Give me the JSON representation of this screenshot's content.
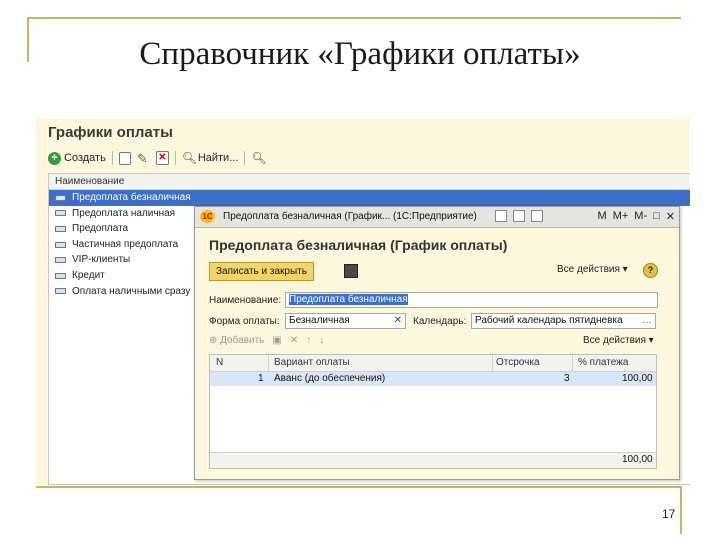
{
  "slide": {
    "title": "Справочник «Графики оплаты»",
    "page_number": "17"
  },
  "list_form": {
    "title": "Графики оплаты",
    "toolbar": {
      "create_label": "Создать",
      "find_label": "Найти..."
    },
    "column_header": "Наименование",
    "items": [
      "Предоплата безналичная",
      "Предоплата наличная",
      "Предоплата",
      "Частичная предоплата",
      "VIP-клиенты",
      "Кредит",
      "Оплата наличными сразу"
    ],
    "selected_index": 0
  },
  "dialog": {
    "window_title": "Предоплата безналичная (График... (1С:Предприятие)",
    "window_controls": [
      "M",
      "M+",
      "M-",
      "□",
      "✕"
    ],
    "heading": "Предоплата безналичная (График оплаты)",
    "save_close_label": "Записать и закрыть",
    "all_actions_label": "Все действия ▾",
    "help_label": "?",
    "name_label": "Наименование:",
    "name_value": "Предоплата безналичная",
    "payment_form_label": "Форма оплаты:",
    "payment_form_value": "Безналичная",
    "calendar_label": "Календарь:",
    "calendar_value": "Рабочий календарь пятидневка",
    "add_label": "Добавить",
    "table_all_actions_label": "Все действия ▾",
    "table": {
      "headers": [
        "N",
        "Вариант оплаты",
        "Отсрочка",
        "% платежа"
      ],
      "rows": [
        {
          "n": "1",
          "variant": "Аванс (до обеспечения)",
          "delay": "3",
          "percent": "100,00"
        }
      ],
      "total": "100,00"
    }
  },
  "colors": {
    "accent_gold": "#c9b56a",
    "selection_blue": "#3d6fc8",
    "form_bg": "#fbf8de"
  }
}
